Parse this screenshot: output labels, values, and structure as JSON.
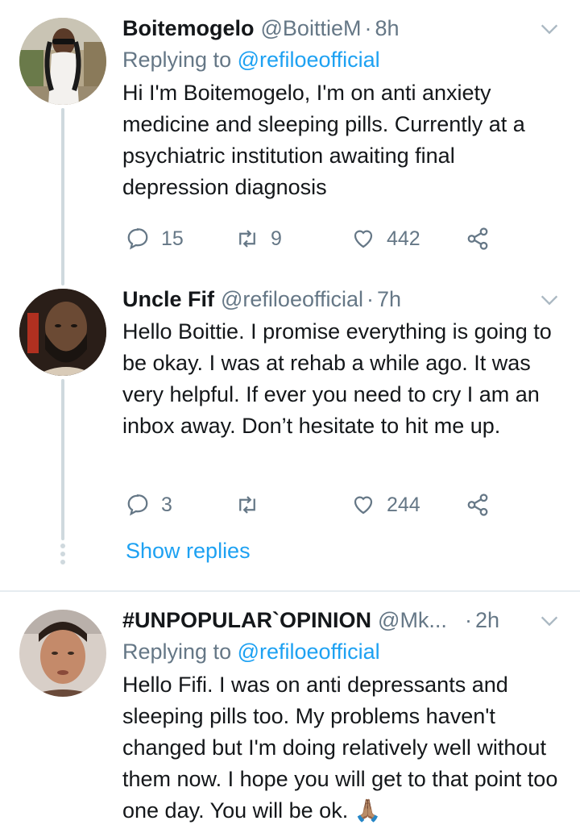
{
  "tweets": [
    {
      "name": "Boitemogelo",
      "handle": "@BoittieM",
      "time": "8h",
      "replying_prefix": "Replying to",
      "replying_to": "@refiloeofficial",
      "text": "Hi I'm Boitemogelo,  I'm on anti anxiety medicine and sleeping pills. Currently at a psychiatric institution awaiting final depression diagnosis",
      "replies": "15",
      "retweets": "9",
      "likes": "442"
    },
    {
      "name": "Uncle Fif",
      "handle": "@refiloeofficial",
      "time": "7h",
      "text": "Hello Boittie. I promise everything is going to be okay. I was at rehab a while ago. It was very helpful. If ever you need to cry I am an inbox away. Don’t hesitate to hit me up.",
      "replies": "3",
      "retweets": "",
      "likes": "244"
    },
    {
      "name": "#UNPOPULAR`OPINION",
      "handle": "@Mk...",
      "time": "2h",
      "replying_prefix": "Replying to",
      "replying_to": "@refiloeofficial",
      "text": "Hello Fifi. I was on anti depressants and sleeping pills too. My problems haven't changed but I'm doing relatively well without them now. I hope you will get to that point too one day. You will be ok. 🙏🏽"
    }
  ],
  "show_replies": "Show replies",
  "colors": {
    "link": "#1da1f2",
    "muted": "#657786",
    "line": "#cfd9de"
  }
}
